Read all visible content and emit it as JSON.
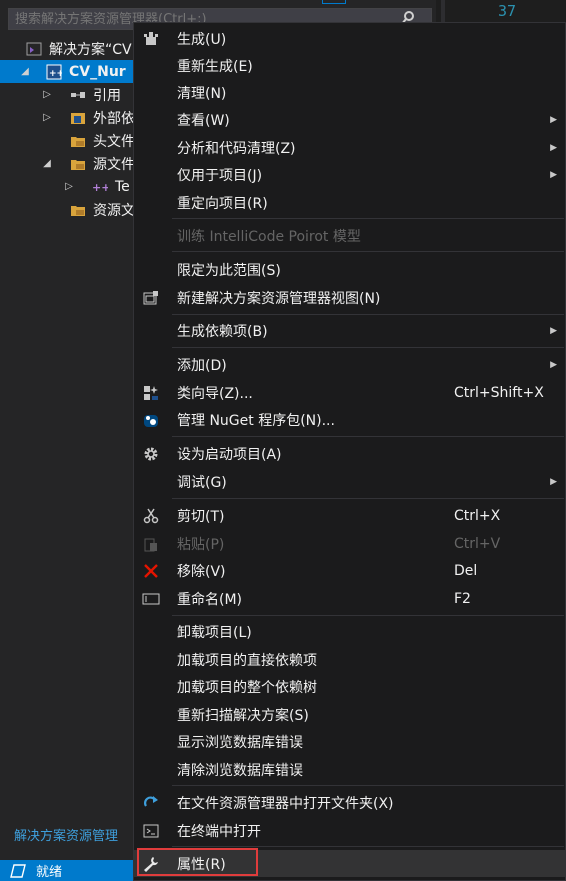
{
  "explorer": {
    "search_placeholder": "搜索解决方案资源管理器(Ctrl+;)",
    "tree": [
      {
        "label": "解决方案“CV",
        "selected": false
      },
      {
        "label": "CV_Nur",
        "selected": true
      },
      {
        "label": "引用",
        "selected": false
      },
      {
        "label": "外部依",
        "selected": false
      },
      {
        "label": "头文件",
        "selected": false
      },
      {
        "label": "源文件",
        "selected": false
      },
      {
        "label": "Te",
        "selected": false
      },
      {
        "label": "资源文",
        "selected": false
      }
    ],
    "footer_label": "解决方案资源管理"
  },
  "editor": {
    "line_number": "37"
  },
  "statusbar": {
    "text": "就绪"
  },
  "menu": {
    "items": [
      {
        "label": "生成(U)",
        "shortcut": ""
      },
      {
        "label": "重新生成(E)",
        "shortcut": ""
      },
      {
        "label": "清理(N)",
        "shortcut": ""
      },
      {
        "label": "查看(W)",
        "shortcut": ""
      },
      {
        "label": "分析和代码清理(Z)",
        "shortcut": ""
      },
      {
        "label": "仅用于项目(J)",
        "shortcut": ""
      },
      {
        "label": "重定向项目(R)",
        "shortcut": ""
      },
      {
        "label": "训练 IntelliCode Poirot 模型",
        "shortcut": ""
      },
      {
        "label": "限定为此范围(S)",
        "shortcut": ""
      },
      {
        "label": "新建解决方案资源管理器视图(N)",
        "shortcut": ""
      },
      {
        "label": "生成依赖项(B)",
        "shortcut": ""
      },
      {
        "label": "添加(D)",
        "shortcut": ""
      },
      {
        "label": "类向导(Z)...",
        "shortcut": "Ctrl+Shift+X"
      },
      {
        "label": "管理 NuGet 程序包(N)...",
        "shortcut": ""
      },
      {
        "label": "设为启动项目(A)",
        "shortcut": ""
      },
      {
        "label": "调试(G)",
        "shortcut": ""
      },
      {
        "label": "剪切(T)",
        "shortcut": "Ctrl+X"
      },
      {
        "label": "粘贴(P)",
        "shortcut": "Ctrl+V"
      },
      {
        "label": "移除(V)",
        "shortcut": "Del"
      },
      {
        "label": "重命名(M)",
        "shortcut": "F2"
      },
      {
        "label": "卸载项目(L)",
        "shortcut": ""
      },
      {
        "label": "加载项目的直接依赖项",
        "shortcut": ""
      },
      {
        "label": "加载项目的整个依赖树",
        "shortcut": ""
      },
      {
        "label": "重新扫描解决方案(S)",
        "shortcut": ""
      },
      {
        "label": "显示浏览数据库错误",
        "shortcut": ""
      },
      {
        "label": "清除浏览数据库错误",
        "shortcut": ""
      },
      {
        "label": "在文件资源管理器中打开文件夹(X)",
        "shortcut": ""
      },
      {
        "label": "在终端中打开",
        "shortcut": ""
      },
      {
        "label": "属性(R)",
        "shortcut": ""
      }
    ]
  },
  "colors": {
    "accent": "#007acc",
    "highlight_outline": "#e03c3c",
    "menu_bg": "#1b1b1c"
  }
}
